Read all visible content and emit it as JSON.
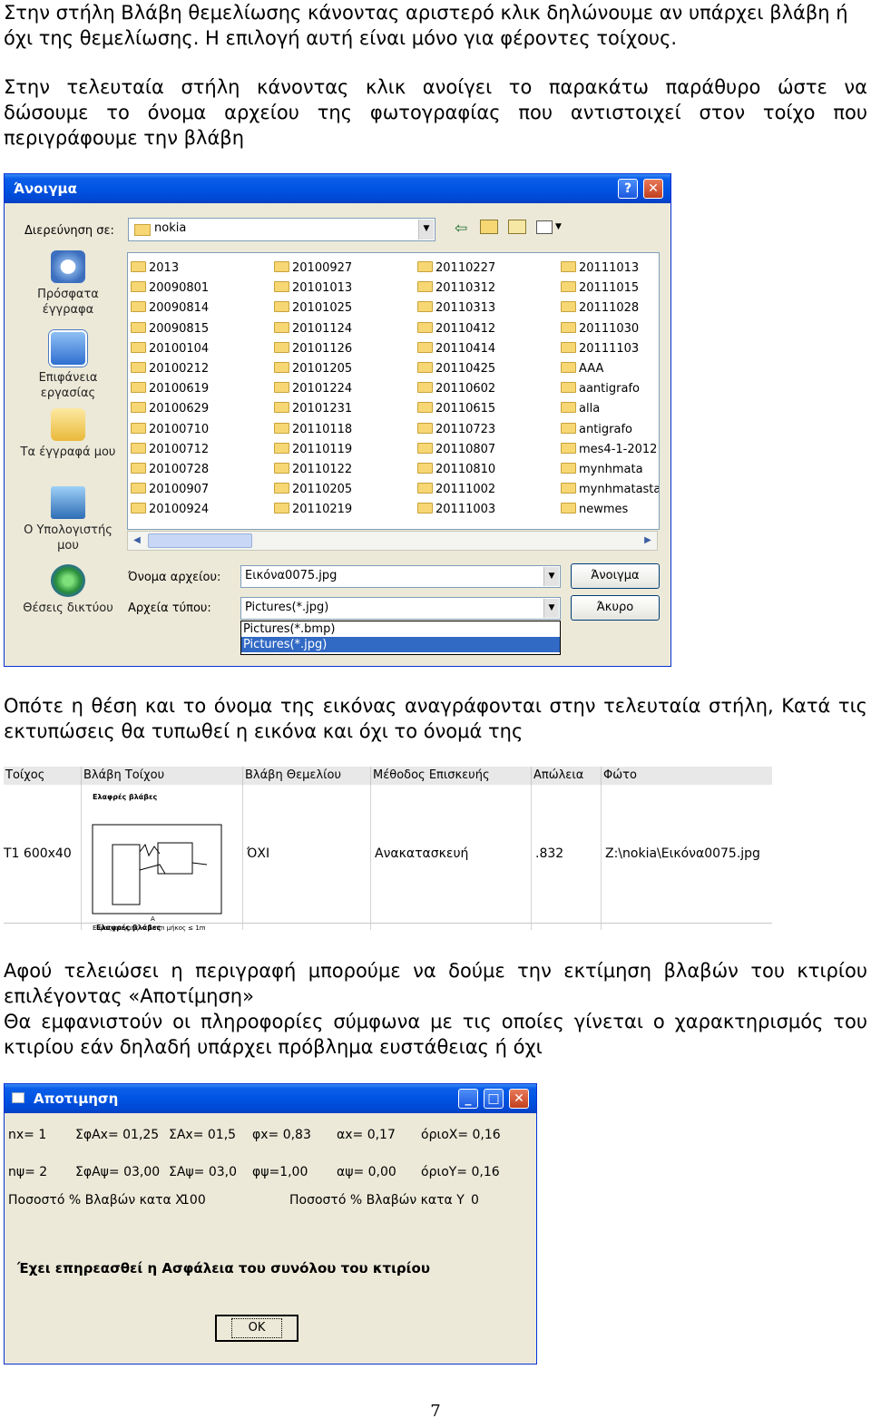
{
  "intro": {
    "line1": "Στην στήλη Βλάβη θεμελίωσης κάνοντας αριστερό κλικ δηλώνουμε αν υπάρχει βλάβη ή",
    "line2": "όχι της θεμελίωσης. Η επιλογή αυτή είναι μόνο για φέροντες τοίχους.",
    "line3": "Στην τελευταία στήλη κάνοντας κλικ ανοίγει το παρακάτω παράθυρο ώστε να",
    "line4": "δώσουμε το όνομα αρχείου της φωτογραφίας που αντιστοιχεί στον τοίχο που",
    "line5": "περιγράφουμε την βλάβη"
  },
  "open_dialog": {
    "title": "Άνοιγμα",
    "help_btn": "?",
    "close_btn": "✕",
    "look_in_label": "Διερεύνηση σε:",
    "look_in_value": "nokia",
    "places": [
      "Πρόσφατα έγγραφα",
      "Επιφάνεια εργασίας",
      "Τα έγγραφά μου",
      "Ο Υπολογιστής μου",
      "Θέσεις δικτύου"
    ],
    "folders_col1": [
      "2013",
      "20090801",
      "20090814",
      "20090815",
      "20100104",
      "20100212",
      "20100619",
      "20100629",
      "20100710",
      "20100712",
      "20100728",
      "20100907",
      "20100924"
    ],
    "folders_col2": [
      "20100927",
      "20101013",
      "20101025",
      "20101124",
      "20101126",
      "20101205",
      "20101224",
      "20101231",
      "20110118",
      "20110119",
      "20110122",
      "20110205",
      "20110219"
    ],
    "folders_col3": [
      "20110227",
      "20110312",
      "20110313",
      "20110412",
      "20110414",
      "20110425",
      "20110602",
      "20110615",
      "20110723",
      "20110807",
      "20110810",
      "20111002",
      "20111003"
    ],
    "folders_col4": [
      "20111013",
      "20111015",
      "20111028",
      "20111030",
      "20111103",
      "AAA",
      "aantigrafo",
      "alla",
      "antigrafo",
      "mes4-1-2012",
      "mynhmata",
      "mynhmatasta",
      "newmes"
    ],
    "filename_label": "Όνομα αρχείου:",
    "filename_value": "Εικόνα0075.jpg",
    "filetype_label": "Αρχεία τύπου:",
    "filetype_value": "Pictures(*.jpg)",
    "filetype_options": [
      "Pictures(*.bmp)",
      "Pictures(*.jpg)"
    ],
    "open_button": "Άνοιγμα",
    "cancel_button": "Άκυρο"
  },
  "middle": {
    "line1": "Οπότε η θέση και το όνομα της εικόνας αναγράφονται στην τελευταία στήλη, Κατά τις",
    "line2": "εκτυπώσεις θα τυπωθεί η εικόνα και όχι το όνομά της"
  },
  "table": {
    "headers": [
      "Τοίχος",
      "Βλάβη Τοίχου",
      "Βλάβη Θεμελίου",
      "Μέθοδος Επισκευής",
      "Απώλεια",
      "Φώτο"
    ],
    "row": [
      "Τ1 600x40",
      "",
      "ΌΧΙ",
      "Ανακατασκευή",
      ".832",
      "Z:\\nokia\\Εικόνα0075.jpg"
    ],
    "sketch_title": "Ελαφρές βλάβες",
    "sketch_caption": "Εύρος ρωγμής < 1mm μήκος ≤ 1m",
    "sketch_letter": "A",
    "sketch_next": "Ελαφρές βλάβες"
  },
  "after": {
    "line1": "Αφού τελειώσει η περιγραφή μπορούμε να δούμε την εκτίμηση βλαβών του κτιρίου",
    "line2": "επιλέγοντας «Αποτίμηση»",
    "line3": "Θα εμφανιστούν οι πληροφορίες σύμφωνα με τις οποίες γίνεται ο χαρακτηρισμός του",
    "line4": "κτιρίου εάν δηλαδή υπάρχει πρόβλημα ευστάθειας ή όχι"
  },
  "apotimisi": {
    "title": "Αποτιμηση",
    "row1": [
      "nx= 1",
      "ΣφΑx= 01,25",
      "ΣΑx= 01,5",
      "φx= 0,83",
      "αx= 0,17",
      "όριοX= 0,16"
    ],
    "row2": [
      "nψ= 2",
      "ΣφΑψ= 03,00",
      "ΣΑψ= 03,0",
      "φψ=1,00",
      "αψ= 0,00",
      "όριοY= 0,16"
    ],
    "pct_x_label": "Ποσοστό % Βλαβών κατα X",
    "pct_x_value": "100",
    "pct_y_label": "Ποσοστό % Βλαβών κατα Y",
    "pct_y_value": "0",
    "message": "Έχει επηρεασθεί η Ασφάλεια του συνόλου του κτιρίου",
    "ok_button": "OK"
  },
  "page_number": "7"
}
